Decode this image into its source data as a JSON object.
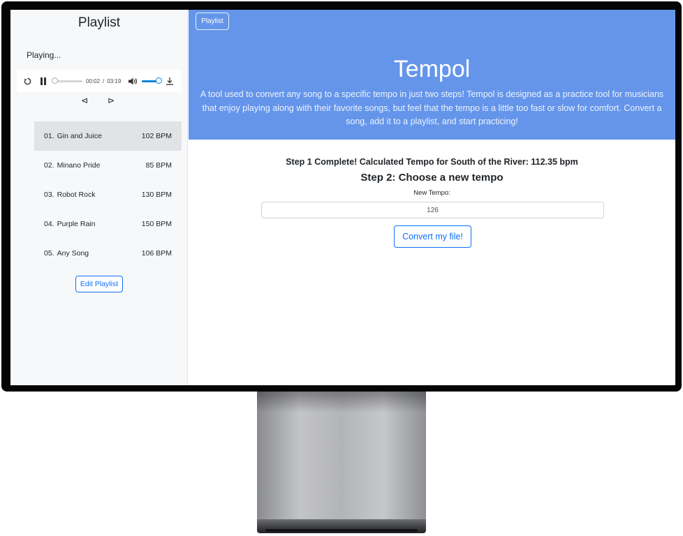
{
  "sidebar": {
    "title": "Playlist",
    "status": "Playing...",
    "player": {
      "current_time": "00:02",
      "separator": "/",
      "duration": "03:19",
      "progress": 0.01,
      "volume": 0.85,
      "icons": {
        "replay": "replay-icon",
        "pause": "pause-icon",
        "volume": "volume-icon",
        "download": "download-icon"
      }
    },
    "nav": {
      "prev_symbol": "⊲",
      "next_symbol": "⊳"
    },
    "songs": [
      {
        "number": "01.",
        "title": "Gin and Juice",
        "bpm": "102 BPM",
        "active": true
      },
      {
        "number": "02.",
        "title": "Minano Pride",
        "bpm": "85 BPM",
        "active": false
      },
      {
        "number": "03.",
        "title": "Robot Rock",
        "bpm": "130 BPM",
        "active": false
      },
      {
        "number": "04.",
        "title": "Purple Rain",
        "bpm": "150 BPM",
        "active": false
      },
      {
        "number": "05.",
        "title": "Any Song",
        "bpm": "106 BPM",
        "active": false
      }
    ],
    "edit_label": "Edit Playlist"
  },
  "header": {
    "playlist_button": "Playlist",
    "title": "Tempol",
    "description": "A tool used to convert any song to a specific tempo in just two steps! Tempol is designed as a practice tool for musicians that enjoy playing along with their favorite songs, but feel that the tempo is a little too fast or slow for comfort. Convert a song, add it to a playlist, and start practicing!",
    "background_color": "#6495ea"
  },
  "main": {
    "step1": "Step 1 Complete! Calculated Tempo for South of the River: 112.35 bpm",
    "step2": "Step 2: Choose a new tempo",
    "tempo_label": "New Tempo:",
    "tempo_value": "126",
    "convert_label": "Convert my file!"
  }
}
